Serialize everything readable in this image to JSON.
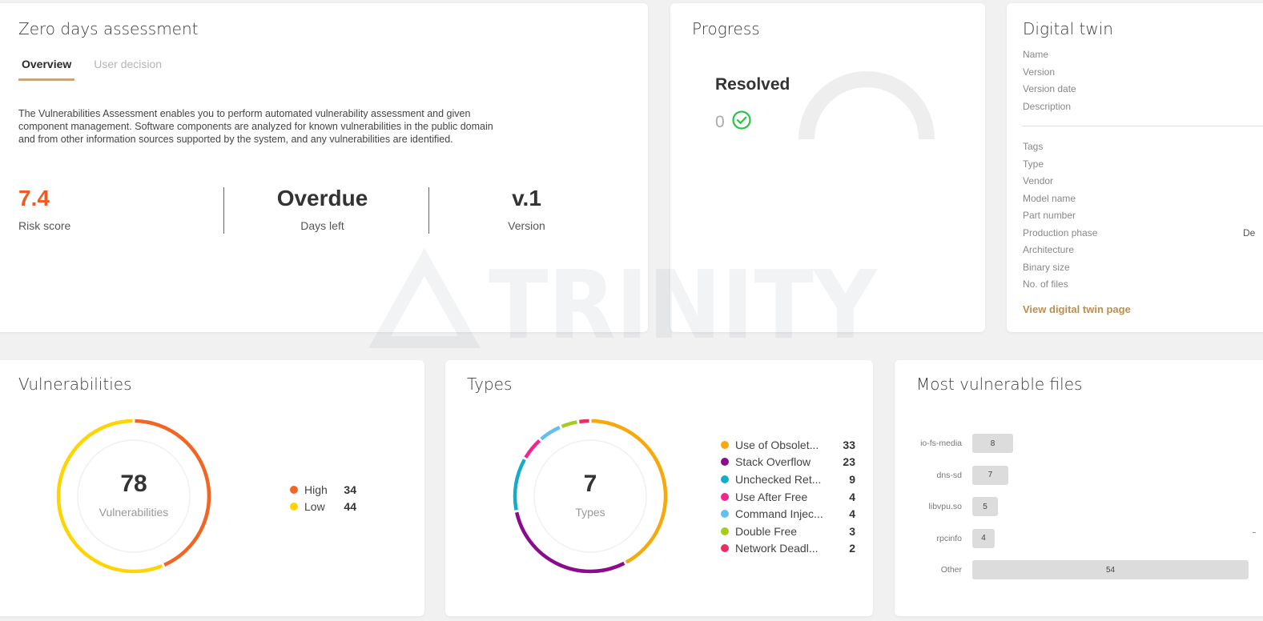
{
  "zero_days": {
    "title": "Zero days assessment",
    "tabs": [
      {
        "label": "Overview",
        "active": true
      },
      {
        "label": "User decision",
        "active": false
      }
    ],
    "description": "The Vulnerabilities Assessment enables you to perform automated vulnerability assessment and given component management. Software components are analyzed for known vulnerabilities in the public domain and from other information sources supported by the system, and any vulnerabilities are identified.",
    "risk": {
      "value": "7.4",
      "label": "Risk score"
    },
    "days": {
      "value": "Overdue",
      "label": "Days left"
    },
    "version": {
      "value": "v.1",
      "label": "Version"
    }
  },
  "progress": {
    "title": "Progress",
    "resolved_label": "Resolved",
    "resolved_value": "0"
  },
  "digital_twin": {
    "title": "Digital twin",
    "fields_top": [
      "Name",
      "Version",
      "Version date",
      "Description"
    ],
    "fields_bottom": [
      "Tags",
      "Type",
      "Vendor",
      "Model name",
      "Part number",
      "Production phase",
      "Architecture",
      "Binary size",
      "No. of files"
    ],
    "production_phase_value": "De",
    "link": "View digital twin page"
  },
  "watermark": "TRINITY",
  "vulnerabilities": {
    "title": "Vulnerabilities",
    "total": "78",
    "total_label": "Vulnerabilities",
    "items": [
      {
        "label": "High",
        "value": 34,
        "color": "#f26522"
      },
      {
        "label": "Low",
        "value": 44,
        "color": "#fed402"
      }
    ]
  },
  "types": {
    "title": "Types",
    "total": "7",
    "total_label": "Types",
    "items": [
      {
        "label": "Use of Obsolet...",
        "value": 33,
        "color": "#f7a90c"
      },
      {
        "label": "Stack Overflow",
        "value": 23,
        "color": "#8a0b8c"
      },
      {
        "label": "Unchecked Ret...",
        "value": 9,
        "color": "#14adc9"
      },
      {
        "label": "Use After Free",
        "value": 4,
        "color": "#f2248f"
      },
      {
        "label": "Command Injec...",
        "value": 4,
        "color": "#63bff0"
      },
      {
        "label": "Double Free",
        "value": 3,
        "color": "#a5cc20"
      },
      {
        "label": "Network Deadl...",
        "value": 2,
        "color": "#ea2e63"
      }
    ]
  },
  "files": {
    "title": "Most vulnerable files",
    "chart_data": {
      "type": "bar",
      "categories": [
        "io-fs-media",
        "dns-sd",
        "libvpu.so",
        "rpcinfo",
        "Other"
      ],
      "values": [
        8,
        7,
        5,
        4,
        54
      ]
    }
  }
}
